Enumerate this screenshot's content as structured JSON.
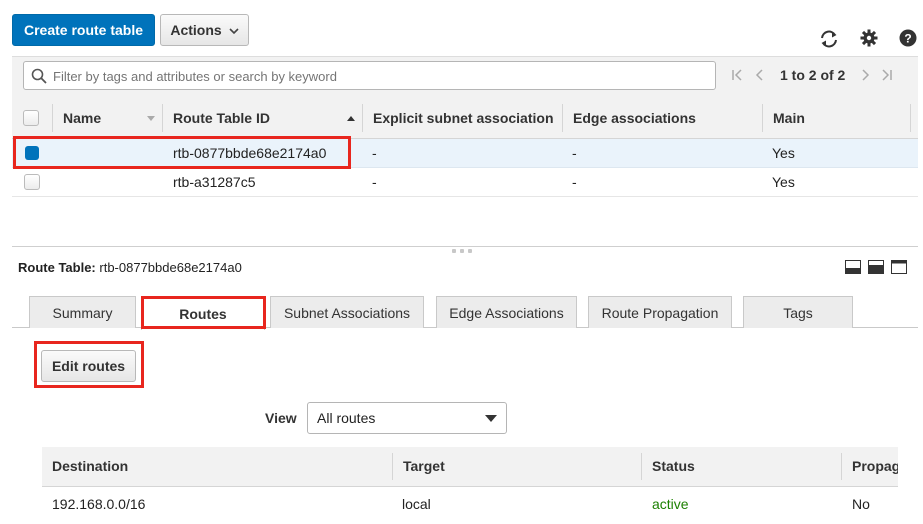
{
  "toolbar": {
    "create_label": "Create route table",
    "actions_label": "Actions",
    "icons": [
      "refresh-icon",
      "gear-icon",
      "help-icon"
    ]
  },
  "filter": {
    "placeholder": "Filter by tags and attributes or search by keyword",
    "pagination": "1 to 2 of 2"
  },
  "table": {
    "columns": [
      "Name",
      "Route Table ID",
      "Explicit subnet association",
      "Edge associations",
      "Main"
    ],
    "rows": [
      {
        "name": "",
        "id": "rtb-0877bbde68e2174a0",
        "explicit": "-",
        "edge": "-",
        "main": "Yes",
        "selected": true
      },
      {
        "name": "",
        "id": "rtb-a31287c5",
        "explicit": "-",
        "edge": "-",
        "main": "Yes",
        "selected": false
      }
    ]
  },
  "detail": {
    "label": "Route Table:",
    "value": "rtb-0877bbde68e2174a0",
    "tabs": [
      "Summary",
      "Routes",
      "Subnet Associations",
      "Edge Associations",
      "Route Propagation",
      "Tags"
    ],
    "active_tab": "Routes",
    "edit_routes_label": "Edit routes",
    "view_label": "View",
    "view_selected": "All routes",
    "routes_columns": [
      "Destination",
      "Target",
      "Status",
      "Propag"
    ],
    "routes": [
      {
        "destination": "192.168.0.0/16",
        "target": "local",
        "status": "active",
        "propagated": "No"
      }
    ]
  },
  "colors": {
    "primary": "#0073bb",
    "highlight": "#e8261e",
    "selected_row": "#eaf3fb",
    "active_status": "#1d8102"
  }
}
